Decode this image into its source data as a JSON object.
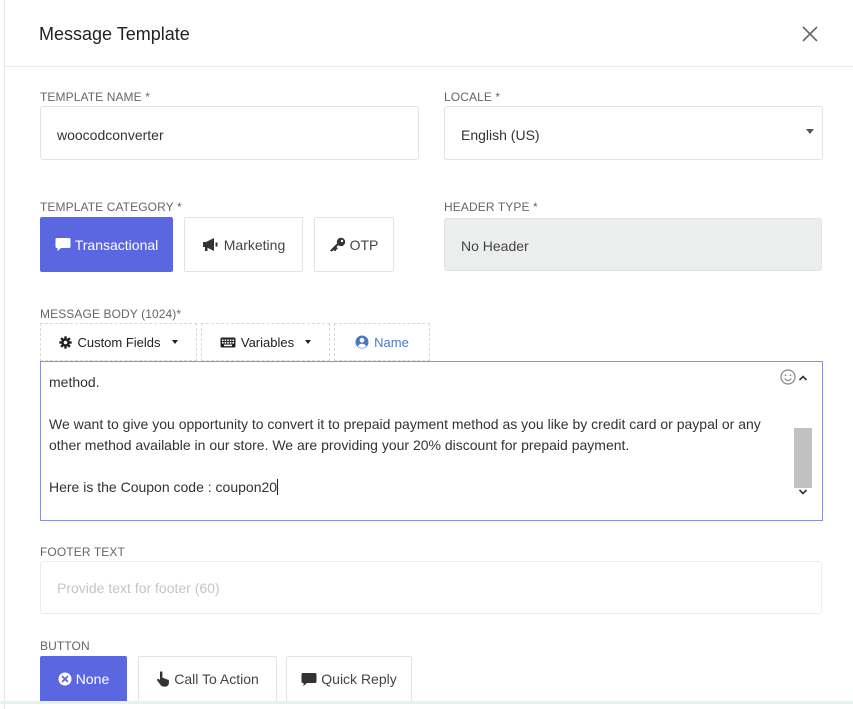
{
  "modal": {
    "title": "Message Template"
  },
  "template_name": {
    "label": "TEMPLATE NAME *",
    "value": "woocodconverter"
  },
  "locale": {
    "label": "LOCALE *",
    "selected": "English (US)"
  },
  "template_category": {
    "label": "TEMPLATE CATEGORY *",
    "options": [
      {
        "label": "Transactional",
        "icon": "comment-icon",
        "active": true
      },
      {
        "label": "Marketing",
        "icon": "megaphone-icon",
        "active": false
      },
      {
        "label": "OTP",
        "icon": "key-icon",
        "active": false
      }
    ]
  },
  "header_type": {
    "label": "HEADER TYPE *",
    "value": "No Header"
  },
  "message_body": {
    "label": "MESSAGE BODY (1024)*",
    "toolbar": {
      "custom_fields": "Custom Fields",
      "variables": "Variables",
      "name": "Name"
    },
    "lines": [
      "method.",
      "We want to give you opportunity to convert it to prepaid payment method as you like by credit card or paypal or any other method available in our store. We are providing your 20% discount for prepaid payment.",
      "Here is the Coupon code : coupon20"
    ]
  },
  "footer": {
    "label": "FOOTER TEXT",
    "placeholder": "Provide text for footer (60)"
  },
  "button": {
    "label": "BUTTON",
    "options": [
      {
        "label": "None",
        "icon": "x-circle-icon",
        "active": true
      },
      {
        "label": "Call To Action",
        "icon": "hand-pointer-icon",
        "active": false
      },
      {
        "label": "Quick Reply",
        "icon": "comment-icon",
        "active": false
      }
    ]
  },
  "colors": {
    "accent": "#5a67e0",
    "link": "#4a78c9",
    "editor_border": "#8a91d9"
  }
}
